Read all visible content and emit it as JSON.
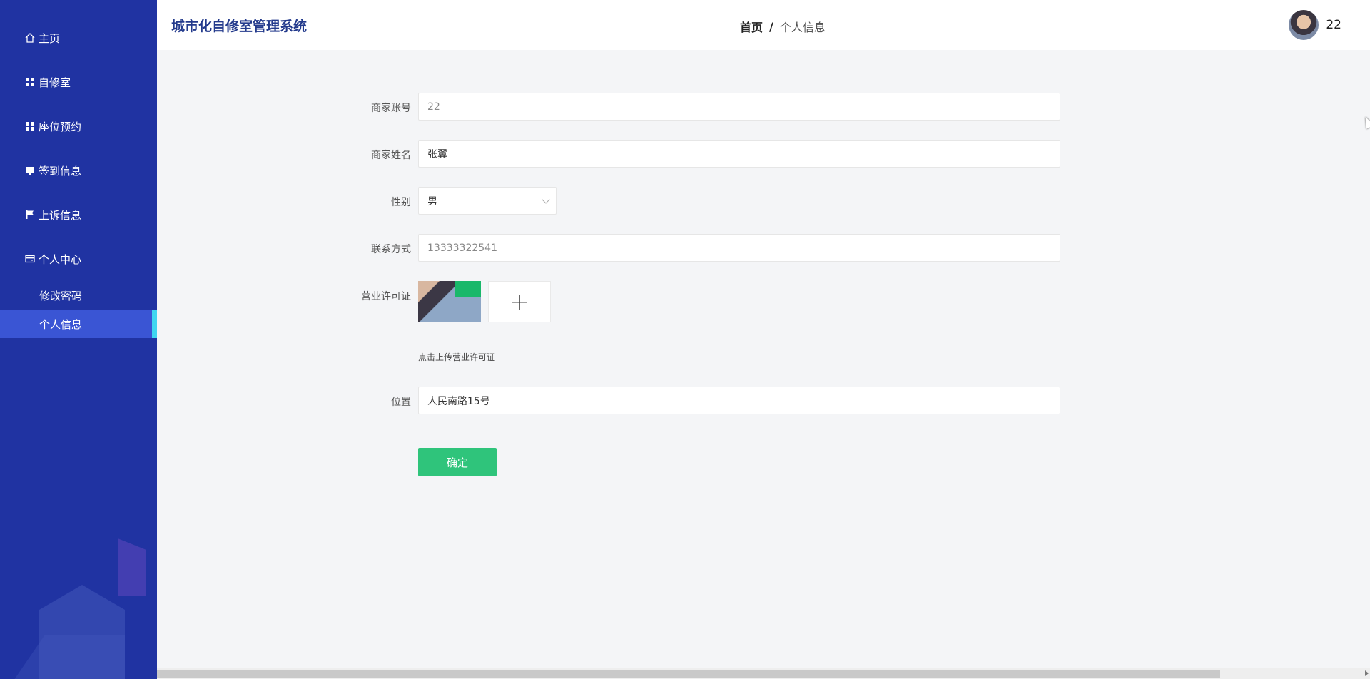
{
  "app": {
    "title": "城市化自修室管理系统"
  },
  "breadcrumb": {
    "home": "首页",
    "separator": "/",
    "current": "个人信息"
  },
  "user": {
    "name": "22"
  },
  "sidebar": {
    "items": [
      {
        "label": "主页",
        "icon": "home-icon"
      },
      {
        "label": "自修室",
        "icon": "grid-icon"
      },
      {
        "label": "座位预约",
        "icon": "grid-icon"
      },
      {
        "label": "签到信息",
        "icon": "monitor-icon"
      },
      {
        "label": "上诉信息",
        "icon": "flag-icon"
      },
      {
        "label": "个人中心",
        "icon": "card-icon"
      }
    ],
    "subitems": [
      {
        "label": "修改密码"
      },
      {
        "label": "个人信息"
      }
    ]
  },
  "form": {
    "account": {
      "label": "商家账号",
      "value": "22"
    },
    "name": {
      "label": "商家姓名",
      "value": "张翼"
    },
    "gender": {
      "label": "性别",
      "value": "男"
    },
    "contact": {
      "label": "联系方式",
      "value": "13333322541"
    },
    "license": {
      "label": "营业许可证",
      "plus": "+",
      "hint": "点击上传营业许可证"
    },
    "location": {
      "label": "位置",
      "value": "人民南路15号"
    },
    "submit": "确定"
  },
  "colors": {
    "sidebar": "#2033a2",
    "active": "#3a55d4",
    "accent": "#3fd6f0",
    "button": "#2fc47b",
    "title": "#233a8c"
  }
}
